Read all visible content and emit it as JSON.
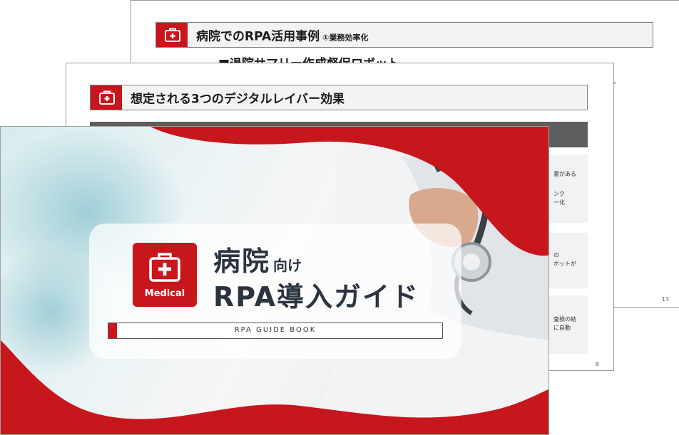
{
  "colors": {
    "brand_red": "#c8161d",
    "dark_text": "#2b3440",
    "header_bg": "#f3f3f3",
    "band_gray": "#5e5e5e"
  },
  "back_slide": {
    "header_title": "病院でのRPA活用事例",
    "header_subtitle": "①業務効率化",
    "subtitle": "■退院サマリー作成督促ロボット",
    "fragment": "す。",
    "page": "13",
    "icon": "medical-kit-icon"
  },
  "middle_slide": {
    "header_title": "想定される3つのデジタルレイバー効果",
    "cards": [
      {
        "lines": [
          "書がある",
          "",
          "ンク",
          "ー化"
        ]
      },
      {
        "lines": [
          "の",
          "ボットが"
        ]
      },
      {
        "lines": [
          "査検の結",
          "に自動"
        ]
      }
    ],
    "page": "8",
    "icon": "medical-kit-icon"
  },
  "cover": {
    "title_main": "病院",
    "title_suffix": "向け",
    "title_line2": "RPA導入ガイド",
    "badge_label": "Medical",
    "guide_label": "RPA GUIDE BOOK",
    "icon": "medical-kit-icon"
  }
}
